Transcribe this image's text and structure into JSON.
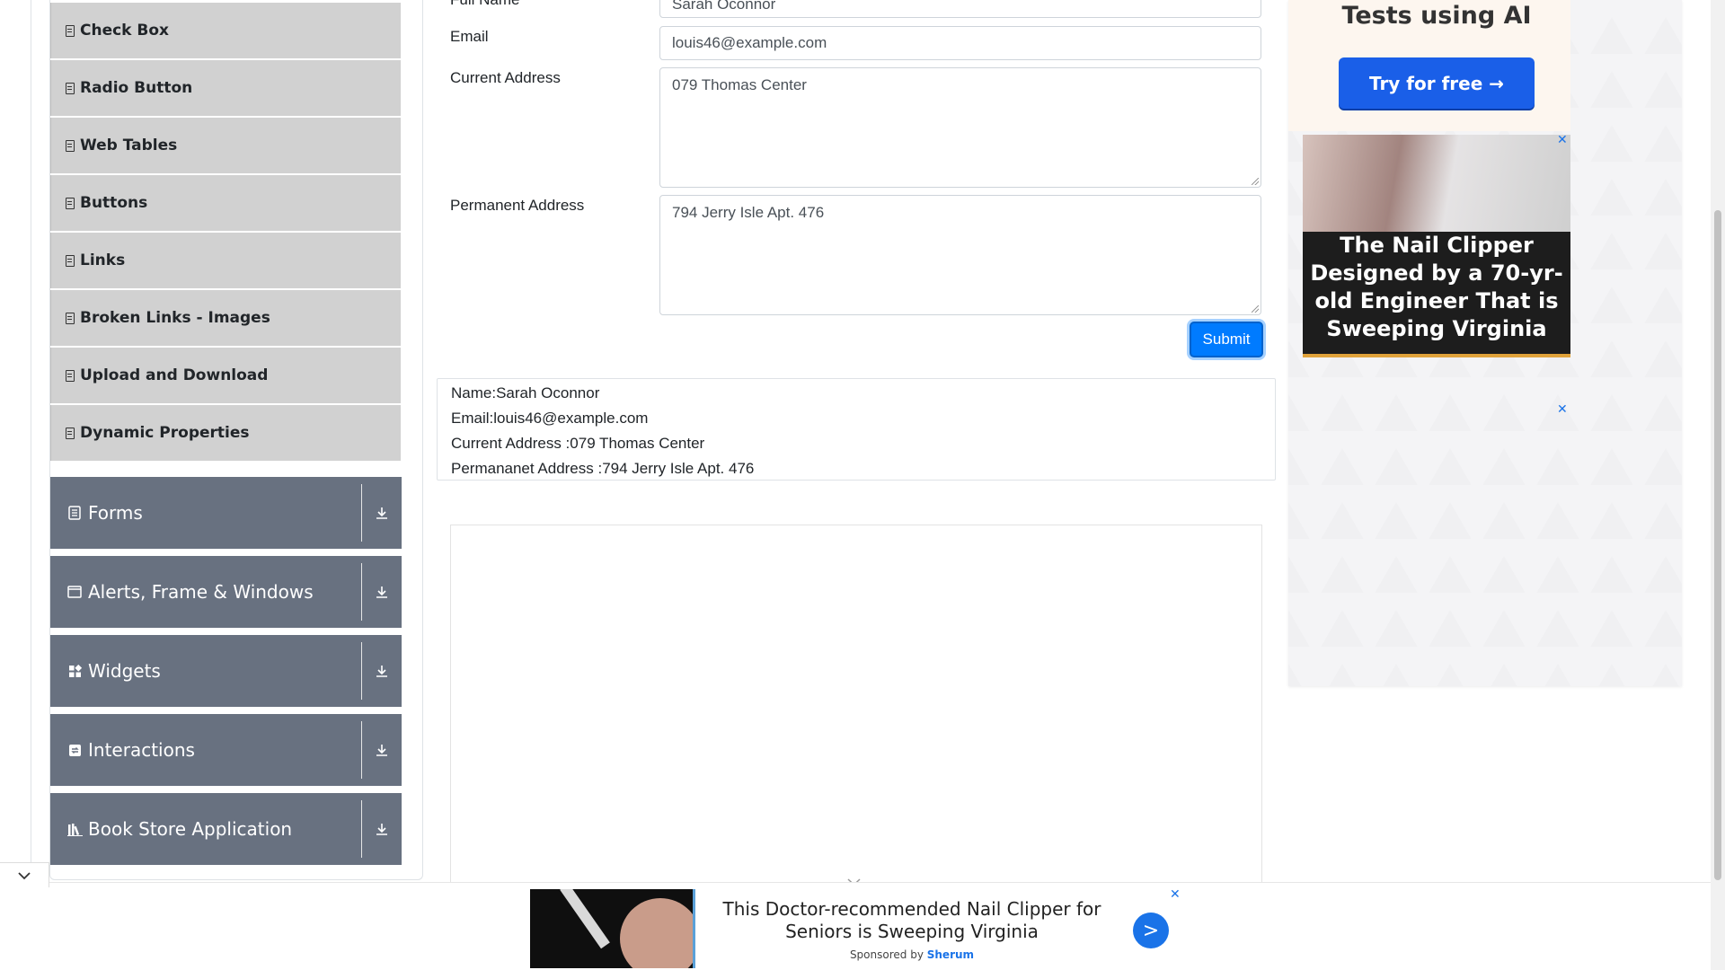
{
  "sidebar": {
    "elements_items": [
      {
        "label": "Check Box",
        "icon": "list-item-icon"
      },
      {
        "label": "Radio Button",
        "icon": "list-item-icon"
      },
      {
        "label": "Web Tables",
        "icon": "list-item-icon"
      },
      {
        "label": "Buttons",
        "icon": "list-item-icon"
      },
      {
        "label": "Links",
        "icon": "list-item-icon"
      },
      {
        "label": "Broken Links - Images",
        "icon": "list-item-icon"
      },
      {
        "label": "Upload and Download",
        "icon": "list-item-icon"
      },
      {
        "label": "Dynamic Properties",
        "icon": "list-item-icon"
      }
    ],
    "groups": [
      {
        "label": "Forms",
        "icon": "form-icon"
      },
      {
        "label": "Alerts, Frame & Windows",
        "icon": "window-icon"
      },
      {
        "label": "Widgets",
        "icon": "widgets-icon"
      },
      {
        "label": "Interactions",
        "icon": "interactions-icon"
      },
      {
        "label": "Book Store Application",
        "icon": "book-icon"
      }
    ]
  },
  "form": {
    "full_name_label": "Full Name",
    "full_name_value": "Sarah Oconnor",
    "email_label": "Email",
    "email_value": "louis46@example.com",
    "current_address_label": "Current Address",
    "current_address_value": "079 Thomas Center",
    "permanent_address_label": "Permanent Address",
    "permanent_address_value": "794 Jerry Isle Apt. 476",
    "submit_label": "Submit"
  },
  "output": {
    "name": "Name:Sarah Oconnor",
    "email": "Email:louis46@example.com",
    "current_address": "Current Address :079 Thomas Center",
    "permanent_address": "Permananet Address :794 Jerry Isle Apt. 476"
  },
  "ads": {
    "top_heading": "Tests using AI",
    "top_button": "Try for free →",
    "image_ad_text": "The Nail Clipper Designed by a 70-yr-old Engineer That is Sweeping Virginia",
    "close_glyph": "✕",
    "bottom_text": "This Doctor-recommended Nail Clipper for Seniors is Sweeping Virginia",
    "sponsored_prefix": "Sponsored by",
    "sponsored_brand": "Sherum",
    "go_glyph": ">"
  },
  "colors": {
    "accent": "#007bff",
    "sidebar_group_bg": "#687180",
    "sidebar_item_bg": "#d1d1d1"
  }
}
